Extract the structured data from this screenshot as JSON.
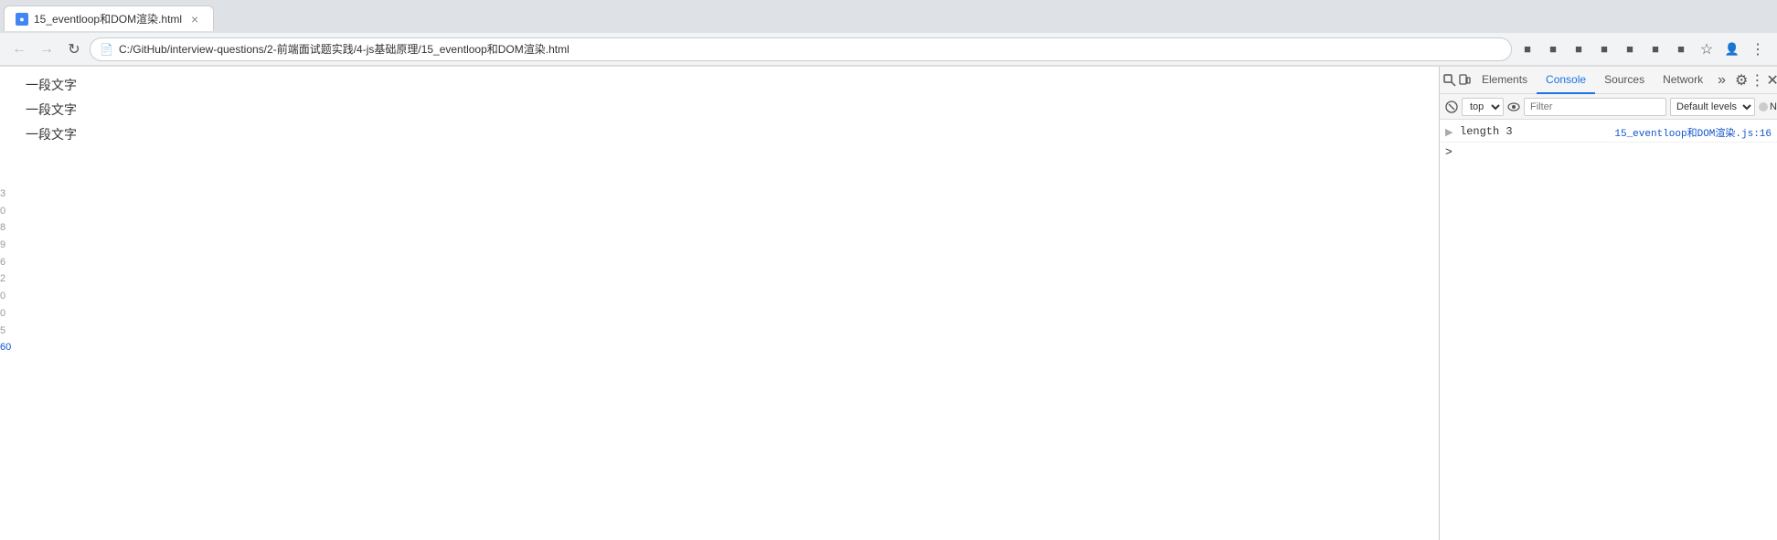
{
  "browser": {
    "tab": {
      "title": "15_eventloop和DOM渲染.html",
      "favicon_letter": "●"
    },
    "addressBar": {
      "url": "C:/GitHub/interview-questions/2-前端面试题实践/4-js基础原理/15_eventloop和DOM渲染.html",
      "lockIcon": "📄"
    },
    "nav": {
      "back": "←",
      "forward": "→",
      "reload": "↺",
      "back_disabled": true,
      "forward_disabled": true
    }
  },
  "page": {
    "lines": [
      {
        "text": "一段文字"
      },
      {
        "text": "一段文字"
      },
      {
        "text": "一段文字"
      }
    ],
    "left_numbers": [
      "3",
      "0",
      "8",
      "9",
      "6",
      "2",
      "0",
      "0",
      "5",
      "60"
    ]
  },
  "devtools": {
    "tabs": [
      {
        "label": "Elements",
        "active": false
      },
      {
        "label": "Console",
        "active": true
      },
      {
        "label": "Sources",
        "active": false
      },
      {
        "label": "Network",
        "active": false
      }
    ],
    "tabs_more": "»",
    "console": {
      "context": "top",
      "filter_placeholder": "Filter",
      "filter_value": "",
      "level": "Default levels",
      "no_errors_label": "No",
      "rows": [
        {
          "key": "length_row",
          "expand": "",
          "msg": "length 3",
          "source": "15_eventloop和DOM渲染.js:16"
        }
      ],
      "prompt_symbol": ">"
    },
    "icons": {
      "inspect": "⊡",
      "device": "▭",
      "settings": "⚙",
      "more": "⋮",
      "close": "✕",
      "clear": "🚫",
      "eye": "👁",
      "dock_side": "⊞",
      "undock": "⊟"
    }
  }
}
